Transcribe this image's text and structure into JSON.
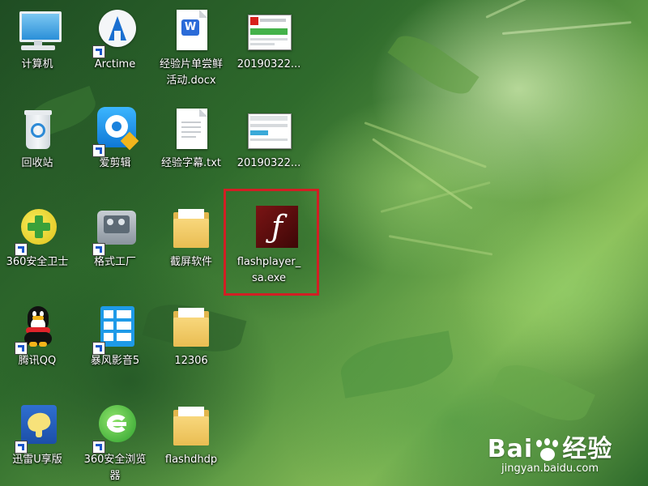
{
  "desktop": {
    "icons": [
      {
        "id": "computer",
        "label": "计算机",
        "shortcut": false
      },
      {
        "id": "arctime",
        "label": "Arctime",
        "shortcut": true
      },
      {
        "id": "docx",
        "label": "经验片单尝鲜\n活动.docx",
        "shortcut": false
      },
      {
        "id": "img1",
        "label": "20190322...",
        "shortcut": false
      },
      {
        "id": "recycle",
        "label": "回收站",
        "shortcut": false
      },
      {
        "id": "aijianji",
        "label": "爱剪辑",
        "shortcut": true
      },
      {
        "id": "txt",
        "label": "经验字幕.txt",
        "shortcut": false
      },
      {
        "id": "img2",
        "label": "20190322...",
        "shortcut": false
      },
      {
        "id": "360safe",
        "label": "360安全卫士",
        "shortcut": true
      },
      {
        "id": "format",
        "label": "格式工厂",
        "shortcut": true
      },
      {
        "id": "screenshot-folder",
        "label": "截屏软件",
        "shortcut": false
      },
      {
        "id": "flashplayer",
        "label": "flashplayer_\nsa.exe",
        "shortcut": false
      },
      {
        "id": "qq",
        "label": "腾讯QQ",
        "shortcut": true
      },
      {
        "id": "baofeng",
        "label": "暴风影音5",
        "shortcut": true
      },
      {
        "id": "folder12306",
        "label": "12306",
        "shortcut": false
      },
      {
        "id": "xunlei",
        "label": "迅雷U享版",
        "shortcut": true
      },
      {
        "id": "360browser",
        "label": "360安全浏览\n器",
        "shortcut": true
      },
      {
        "id": "flashdhdp",
        "label": "flashdhdp",
        "shortcut": false
      }
    ]
  },
  "selection": {
    "target": "flashplayer",
    "color": "#d11f24"
  },
  "watermark": {
    "logo_left": "Bai",
    "logo_right": "经验",
    "url": "jingyan.baidu.com"
  },
  "colors": {
    "accent_red": "#d11f24",
    "flash_bg": "#5a0e0e",
    "word_blue": "#2b6bd8",
    "folder_yellow": "#f0c860"
  }
}
